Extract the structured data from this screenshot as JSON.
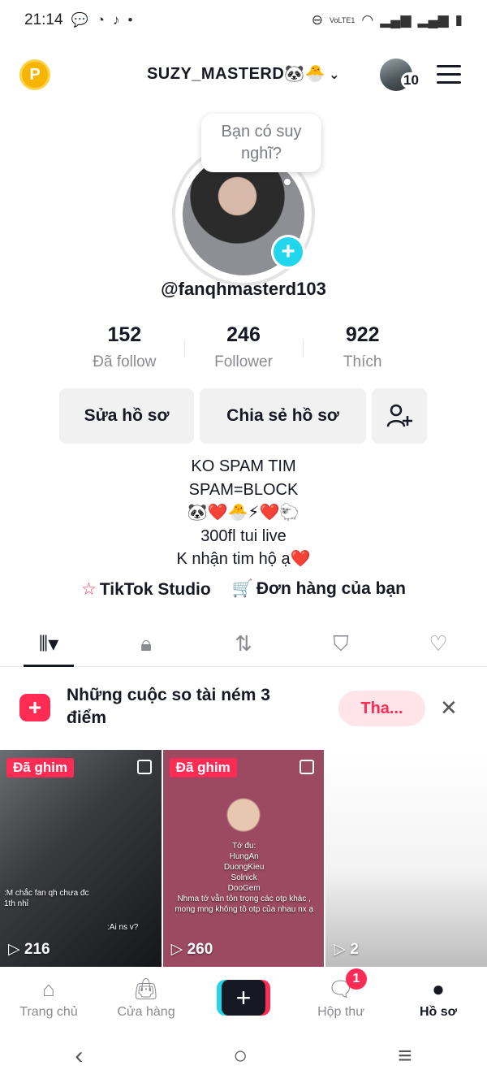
{
  "status_bar": {
    "time": "21:14",
    "network": "VoLTE1"
  },
  "header": {
    "username": "SUZY_MASTERD🐼🐣",
    "coin": "P",
    "notif_count": "10"
  },
  "profile": {
    "note_bubble": "Bạn có suy nghĩ?",
    "handle": "@fanqhmasterd103",
    "stats": [
      {
        "value": "152",
        "label": "Đã follow"
      },
      {
        "value": "246",
        "label": "Follower"
      },
      {
        "value": "922",
        "label": "Thích"
      }
    ],
    "buttons": {
      "edit": "Sửa hồ sơ",
      "share": "Chia sẻ hồ sơ"
    },
    "bio": [
      "KO SPAM TIM",
      "SPAM=BLOCK",
      "🐼❤️🐣⚡❤️🐑",
      "300fl tui live",
      "K nhận tim hộ ạ❤️"
    ],
    "links": {
      "studio": "TikTok Studio",
      "orders": "Đơn hàng của bạn"
    }
  },
  "tabs": [
    "videos",
    "private",
    "reposts",
    "favorites",
    "liked"
  ],
  "promo": {
    "text": "Những cuộc so tài ném 3 điểm",
    "button": "Tha..."
  },
  "videos": [
    {
      "pinned": "Đã ghim",
      "views": "216",
      "overlay": ":M chắc fan qh chưa đc 1th nhỉ",
      "overlay2": ":Ai ns v?"
    },
    {
      "pinned": "Đã ghim",
      "views": "260",
      "overlay": "Tớ đu:\nHungAn\nDuongKieu\nSolnick\nDooGem\nNhma tớ vẫn tôn trọng các otp khác , mong mng không tô otp của nhau nx ạ"
    },
    {
      "views": "2"
    }
  ],
  "bottom_nav": {
    "home": "Trang chủ",
    "shop": "Cửa hàng",
    "inbox": "Hộp thư",
    "inbox_badge": "1",
    "profile": "Hồ sơ"
  },
  "colors": {
    "accent": "#fe2c55",
    "cyan": "#20d5ec",
    "text": "#161823",
    "muted": "#8a8b91"
  }
}
